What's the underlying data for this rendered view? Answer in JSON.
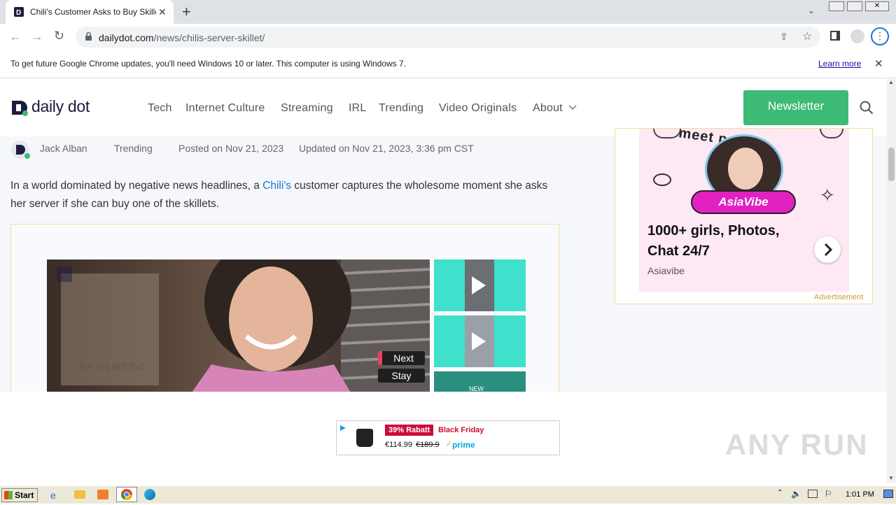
{
  "browser": {
    "tab_title": "Chili's Customer Asks to Buy Skillet A",
    "url_domain": "dailydot.com",
    "url_path": "/news/chilis-server-skillet/",
    "infobar_text": "To get future Google Chrome updates, you'll need Windows 10 or later. This computer is using Windows 7.",
    "infobar_link": "Learn more"
  },
  "site": {
    "logo_text": "daily dot",
    "nav": [
      "Tech",
      "Internet Culture",
      "Streaming",
      "IRL",
      "Trending",
      "Video Originals",
      "About"
    ],
    "newsletter_label": "Newsletter"
  },
  "article": {
    "author": "Jack Alban",
    "category": "Trending",
    "posted": "Posted on Nov 21, 2023",
    "updated": "Updated on Nov 21, 2023, 3:36 pm CST",
    "lede_before": "In a world dominated by negative news headlines, a ",
    "lede_link": "Chili's",
    "lede_after": " customer captures the wholesome moment she asks her server if she can buy one of the skillets."
  },
  "video": {
    "caption": "Are you ok? No?",
    "next_label": "Next",
    "stay_label": "Stay",
    "thumb3_label": "NEW"
  },
  "sidebar_ad": {
    "top_text": "meet people",
    "brand_badge": "AsiaVibe",
    "headline": "1000+ girls, Photos, Chat 24/7",
    "advertiser": "Asiavibe",
    "ad_label": "Advertisement"
  },
  "shop_ad": {
    "discount": "39% Rabatt",
    "event": "Black Friday",
    "price": "€114.99",
    "old_price": "€189.9",
    "prime": "prime"
  },
  "taskbar": {
    "start_label": "Start",
    "clock": "1:01 PM"
  },
  "watermark": "ANY RUN"
}
